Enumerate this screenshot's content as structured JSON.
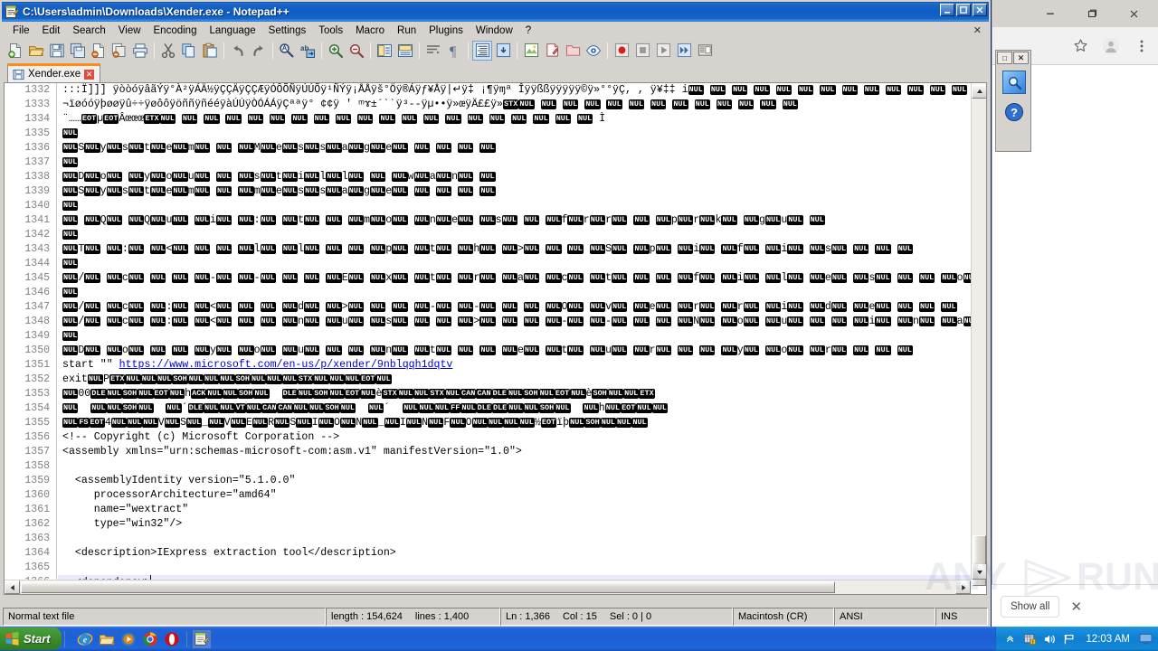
{
  "notepad": {
    "title": "C:\\Users\\admin\\Downloads\\Xender.exe - Notepad++",
    "title_icon": "notepad-plus-plus-icon",
    "window_buttons": {
      "minimize": "_",
      "maximize": "□",
      "close": "✕"
    },
    "menubar": {
      "items": [
        "File",
        "Edit",
        "Search",
        "View",
        "Encoding",
        "Language",
        "Settings",
        "Tools",
        "Macro",
        "Run",
        "Plugins",
        "Window",
        "?"
      ],
      "close_doc": "✕"
    },
    "toolbar": {
      "buttons": [
        "new-file-icon",
        "open-file-icon",
        "save-icon",
        "save-all-icon",
        "close-file-icon",
        "close-all-icon",
        "print-icon",
        "cut-icon",
        "copy-icon",
        "paste-icon",
        "undo-icon",
        "redo-icon",
        "find-icon",
        "replace-icon",
        "zoom-in-icon",
        "zoom-out-icon",
        "sync-vertical-icon",
        "sync-horizontal-icon",
        "word-wrap-icon",
        "show-all-chars-icon",
        "indent-guide-icon",
        "user-define-dialog-icon",
        "show-document-map-icon",
        "show-function-list-icon",
        "show-folder-as-workspace-icon",
        "show-document-peeker-icon",
        "macro-record-icon",
        "macro-stop-icon",
        "macro-play-icon",
        "macro-playback-multiple-icon",
        "macro-save-icon"
      ]
    },
    "tab": {
      "label": "Xender.exe",
      "icon": "saved-document-icon",
      "close": "✕"
    },
    "editor": {
      "first_line_number": 1332,
      "current_line": 1366,
      "lines": [
        {
          "n": 1332,
          "segments": [
            {
              "t": "text",
              "v": ":::Ï]]] ÿòòóÿâãÝÿ°À²ÿÁÄ½ÿÇÇÄÿÇÇÆÿÓÔÕÑÿÚÚÕÿ¹ÑÝÿ¡ÅÅÿš°Öÿ®Áÿƒ¥Åÿ|↵ÿ‡ ¡¶ÿɱª Îÿÿßßÿÿÿÿÿ©ÿ»°°ÿÇ, , ÿ¥‡‡ i"
            },
            {
              "t": "nul",
              "n": 17
            }
          ]
        },
        {
          "n": 1333,
          "segments": [
            {
              "t": "text",
              "v": "¬ïøóóÿþøøÿû÷÷ÿøôôÿöññÿñééÿàÚÚÿÒÓÁÁÿÇªªÿ° ¢¢ÿ ′ ᵐɤ±´ˋˋÿ³--ÿµ••ÿ»œÿÄ££ÿ»"
            },
            {
              "t": "ctrl",
              "v": "STX"
            },
            {
              "t": "nul",
              "n": 13
            }
          ]
        },
        {
          "n": 1334,
          "segments": [
            {
              "t": "text",
              "v": "¨……"
            },
            {
              "t": "ctrl",
              "v": "EOT"
            },
            {
              "t": "text",
              "v": "µ"
            },
            {
              "t": "ctrl",
              "v": "EOT"
            },
            {
              "t": "text",
              "v": "Âœœœ"
            },
            {
              "t": "ctrl",
              "v": "ETX"
            },
            {
              "t": "nul",
              "n": 20
            },
            {
              "t": "text",
              "v": "Ì"
            }
          ]
        },
        {
          "n": 1335,
          "segments": [
            {
              "t": "nul",
              "n": 1
            }
          ]
        },
        {
          "n": 1336,
          "segments": [
            {
              "t": "utf16",
              "v": "System  Message "
            },
            {
              "t": "nul",
              "n": 4
            }
          ]
        },
        {
          "n": 1337,
          "segments": [
            {
              "t": "nul",
              "n": 1
            }
          ]
        },
        {
          "n": 1338,
          "segments": [
            {
              "t": "utf16",
              "v": "Do you  still  wan"
            },
            {
              "t": "nul",
              "n": 2
            }
          ]
        },
        {
          "n": 1339,
          "segments": [
            {
              "t": "utf16",
              "v": "System  message "
            },
            {
              "t": "nul",
              "n": 4
            }
          ]
        },
        {
          "n": 1340,
          "segments": [
            {
              "t": "nul",
              "n": 1
            }
          ]
        },
        {
          "n": 1341,
          "segments": [
            {
              "t": "utf16",
              "v": " Q Qu i : t  mo ne s  frr  prk gu"
            },
            {
              "t": "nul",
              "n": 2
            }
          ]
        },
        {
          "n": 1342,
          "segments": [
            {
              "t": "nul",
              "n": 1
            }
          ]
        },
        {
          "n": 1343,
          "segments": [
            {
              "t": "utf16",
              "v": "T : <   l l   p t h >   S p i f i s "
            },
            {
              "t": "nul",
              "n": 3
            }
          ]
        },
        {
          "n": 1344,
          "segments": [
            {
              "t": "nul",
              "n": 1
            }
          ]
        },
        {
          "n": 1345,
          "segments": [
            {
              "t": "utf16",
              "v": "/ c   - -   E x t r a c t   f i l e s   o n l y "
            },
            {
              "t": "nul",
              "n": 2
            }
          ]
        },
        {
          "n": 1346,
          "segments": [
            {
              "t": "nul",
              "n": 1
            }
          ]
        },
        {
          "n": 1347,
          "segments": [
            {
              "t": "utf16",
              "v": "/ c : <   d >   - -   O v e r r i d e "
            },
            {
              "t": "nul",
              "n": 3
            }
          ]
        },
        {
          "n": 1348,
          "segments": [
            {
              "t": "utf16",
              "v": "/ c : <   n u s   >   - -   N o u   i n a p "
            },
            {
              "t": "nul",
              "n": 2
            }
          ]
        },
        {
          "n": 1349,
          "segments": [
            {
              "t": "nul",
              "n": 1
            }
          ]
        },
        {
          "n": 1350,
          "segments": [
            {
              "t": "utf16",
              "v": "D o   y o u   n t   e t u r   y o r "
            },
            {
              "t": "nul",
              "n": 3
            }
          ]
        },
        {
          "n": 1351,
          "segments": [
            {
              "t": "text",
              "v": "start \"\" "
            },
            {
              "t": "url",
              "v": "https://www.microsoft.com/en-us/p/xender/9nblqqh1dqtv"
            }
          ]
        },
        {
          "n": 1352,
          "segments": [
            {
              "t": "text",
              "v": "exit"
            },
            {
              "t": "ctrlseq",
              "v": "NUL P ETX NUL NUL NUL SOH NUL NUL NUL SOH NUL NUL NUL STX NUL NUL NUL EOT NUL"
            }
          ]
        },
        {
          "n": 1353,
          "segments": [
            {
              "t": "ctrlseq",
              "v": "NUL 0 0 DLE NUL SOH NUL EOT NUL h ACK NUL NUL SOH NUL   DLE NUL SOH NUL EOT NUL è STX NUL NUL STX NUL CAN CAN DLE NUL SOH NUL EOT NUL è SOH NUL NUL ETX"
            }
          ]
        },
        {
          "n": 1354,
          "segments": [
            {
              "t": "ctrlseq",
              "v": "NUL   NUL NUL SOH NUL   NUL ´ DLE NUL NUL VT NUL CAN CAN NUL NUL SOH NUL   NUL ´   NUL NUL NUL FF NUL DLE DLE NUL NUL SOH NUL   NUL h NUL EOT NUL NUL"
            }
          ]
        },
        {
          "n": 1355,
          "segments": [
            {
              "t": "ctrlseq",
              "v": "NUL FS EOT 4 NUL NUL NUL V NUL S NUL _ NUL V NUL E NUL R NUL S NUL I NUL O NUL N NUL _ NUL I NUL N NUL F NUL O NUL NUL NUL NUL ½ EOT ïþ NUL SOH NUL NUL NUL"
            }
          ]
        },
        {
          "n": 1356,
          "segments": [
            {
              "t": "text",
              "v": "<!-- Copyright (c) Microsoft Corporation -->"
            }
          ]
        },
        {
          "n": 1357,
          "segments": [
            {
              "t": "text",
              "v": "<assembly xmlns=\"urn:schemas-microsoft-com:asm.v1\" manifestVersion=\"1.0\">"
            }
          ]
        },
        {
          "n": 1358,
          "segments": []
        },
        {
          "n": 1359,
          "segments": [
            {
              "t": "text",
              "v": "  <assemblyIdentity version=\"5.1.0.0\""
            }
          ]
        },
        {
          "n": 1360,
          "segments": [
            {
              "t": "text",
              "v": "     processorArchitecture=\"amd64\""
            }
          ]
        },
        {
          "n": 1361,
          "segments": [
            {
              "t": "text",
              "v": "     name=\"wextract\""
            }
          ]
        },
        {
          "n": 1362,
          "segments": [
            {
              "t": "text",
              "v": "     type=\"win32\"/>"
            }
          ]
        },
        {
          "n": 1363,
          "segments": []
        },
        {
          "n": 1364,
          "segments": [
            {
              "t": "text",
              "v": "  <description>IExpress extraction tool</description>"
            }
          ]
        },
        {
          "n": 1365,
          "segments": []
        },
        {
          "n": 1366,
          "segments": [
            {
              "t": "text",
              "v": "  <dependency>"
            },
            {
              "t": "caret",
              "v": ""
            }
          ],
          "current": true
        }
      ]
    },
    "statusbar": {
      "file_type": "Normal text file",
      "length_label": "length : 154,624",
      "lines_label": "lines : 1,400",
      "ln": "Ln : 1,366",
      "col": "Col : 15",
      "sel": "Sel : 0 | 0",
      "eol": "Macintosh (CR)",
      "encoding": "ANSI",
      "insert_mode": "INS"
    }
  },
  "chrome": {
    "window_buttons": {
      "minimize": "—",
      "maximize": "❐",
      "close": "✕"
    },
    "toolbar_icons": [
      "bookmark-star-icon",
      "profile-avatar-icon",
      "chrome-menu-icon"
    ],
    "notification_close": "✕",
    "downloads_shelf": {
      "show_all_label": "Show all",
      "close": "✕"
    },
    "sidebar_icons": [
      "search-icon",
      "help-icon"
    ],
    "sidebar_buttons": {
      "maximize": "□",
      "close": "✕"
    }
  },
  "watermark": {
    "text": "ANY RUN"
  },
  "taskbar": {
    "start_label": "Start",
    "quicklaunch": [
      "internet-explorer-icon",
      "windows-explorer-icon",
      "media-player-icon",
      "google-chrome-icon",
      "opera-icon",
      "notepad-plus-plus-icon"
    ],
    "tray": {
      "show_hidden_icons": "«",
      "icons": [
        "security-shield-icon",
        "volume-icon",
        "network-icon"
      ],
      "clock": "12:03 AM",
      "show_desktop": "show-desktop-icon"
    }
  },
  "colors": {
    "title_blue": "#1862c6",
    "taskbar_blue": "#1e5fd4",
    "start_green": "#3d8f2e",
    "window_face": "#d6d2ce",
    "tab_active_accent": "#ff8c19",
    "current_line": "#e8e8ff",
    "link": "#0000cc"
  }
}
